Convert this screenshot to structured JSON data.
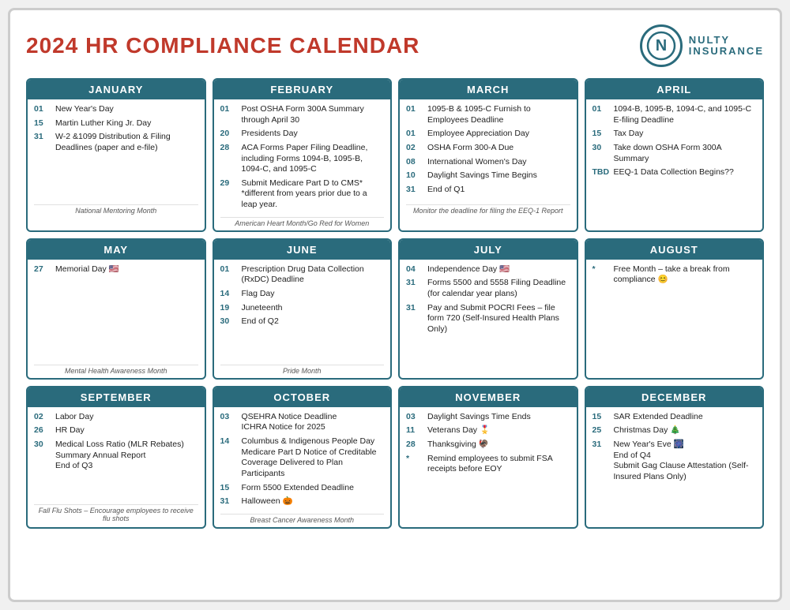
{
  "header": {
    "title": "2024 HR COMPLIANCE CALENDAR",
    "logo_letter": "N",
    "logo_name": "NULTY",
    "logo_sub": "INSURANCE"
  },
  "months": [
    {
      "name": "JANUARY",
      "events": [
        {
          "day": "01",
          "text": "New Year's Day"
        },
        {
          "day": "15",
          "text": "Martin Luther King Jr. Day"
        },
        {
          "day": "31",
          "text": "W-2 &1099 Distribution & Filing Deadlines (paper and e-file)"
        }
      ],
      "footer": "National Mentoring Month"
    },
    {
      "name": "FEBRUARY",
      "events": [
        {
          "day": "01",
          "text": "Post OSHA Form 300A Summary through April 30"
        },
        {
          "day": "20",
          "text": "Presidents Day"
        },
        {
          "day": "28",
          "text": "ACA Forms Paper Filing Deadline, including Forms 1094-B, 1095-B, 1094-C, and 1095-C"
        },
        {
          "day": "29",
          "text": "Submit Medicare Part D to CMS*\n*different from years prior due to a leap year."
        }
      ],
      "footer": "American Heart Month/Go Red for Women"
    },
    {
      "name": "MARCH",
      "events": [
        {
          "day": "01",
          "text": "1095-B & 1095-C Furnish to Employees Deadline"
        },
        {
          "day": "01",
          "text": "Employee Appreciation Day"
        },
        {
          "day": "02",
          "text": "OSHA Form 300-A Due"
        },
        {
          "day": "08",
          "text": "International Women's Day"
        },
        {
          "day": "10",
          "text": "Daylight Savings Time Begins"
        },
        {
          "day": "31",
          "text": "End of Q1"
        }
      ],
      "footer": "Monitor the deadline for filing the EEQ-1 Report"
    },
    {
      "name": "APRIL",
      "events": [
        {
          "day": "01",
          "text": "1094-B, 1095-B, 1094-C, and 1095-C E-filing Deadline"
        },
        {
          "day": "15",
          "text": "Tax Day"
        },
        {
          "day": "30",
          "text": "Take down OSHA Form 300A Summary"
        },
        {
          "day": "TBD",
          "text": "EEQ-1 Data Collection Begins??"
        }
      ],
      "footer": ""
    },
    {
      "name": "MAY",
      "events": [
        {
          "day": "27",
          "text": "Memorial Day 🇺🇸"
        }
      ],
      "footer": "Mental Health Awareness Month"
    },
    {
      "name": "JUNE",
      "events": [
        {
          "day": "01",
          "text": "Prescription Drug Data Collection (RxDC) Deadline"
        },
        {
          "day": "14",
          "text": "Flag Day"
        },
        {
          "day": "19",
          "text": "Juneteenth"
        },
        {
          "day": "30",
          "text": "End of Q2"
        }
      ],
      "footer": "Pride Month"
    },
    {
      "name": "JULY",
      "events": [
        {
          "day": "04",
          "text": "Independence Day 🇺🇸"
        },
        {
          "day": "31",
          "text": "Forms 5500 and 5558 Filing Deadline (for calendar year plans)"
        },
        {
          "day": "31",
          "text": "Pay and Submit POCRI Fees – file form 720 (Self-Insured Health Plans Only)"
        }
      ],
      "footer": ""
    },
    {
      "name": "AUGUST",
      "events": [
        {
          "day": "*",
          "text": "Free Month – take a break from compliance 😊"
        }
      ],
      "footer": ""
    },
    {
      "name": "SEPTEMBER",
      "events": [
        {
          "day": "02",
          "text": "Labor Day"
        },
        {
          "day": "26",
          "text": "HR Day"
        },
        {
          "day": "30",
          "text": "Medical Loss Ratio (MLR Rebates) Summary Annual Report\nEnd of Q3"
        }
      ],
      "footer": "Fall Flu Shots – Encourage employees to receive flu shots"
    },
    {
      "name": "OCTOBER",
      "events": [
        {
          "day": "03",
          "text": "QSEHRA Notice Deadline\nICHRA Notice for 2025"
        },
        {
          "day": "14",
          "text": "Columbus & Indigenous People Day\nMedicare Part D Notice of Creditable Coverage Delivered to Plan Participants"
        },
        {
          "day": "15",
          "text": "Form 5500 Extended Deadline"
        },
        {
          "day": "31",
          "text": "Halloween 🎃"
        }
      ],
      "footer": "Breast Cancer Awareness Month"
    },
    {
      "name": "NOVEMBER",
      "events": [
        {
          "day": "03",
          "text": "Daylight Savings Time Ends"
        },
        {
          "day": "11",
          "text": "Veterans Day 🎖️"
        },
        {
          "day": "28",
          "text": "Thanksgiving 🦃"
        },
        {
          "day": "*",
          "text": "Remind employees to submit FSA receipts before EOY"
        }
      ],
      "footer": ""
    },
    {
      "name": "DECEMBER",
      "events": [
        {
          "day": "15",
          "text": "SAR Extended Deadline"
        },
        {
          "day": "25",
          "text": "Christmas Day 🎄"
        },
        {
          "day": "31",
          "text": "New Year's Eve 🎆\nEnd of Q4\nSubmit Gag Clause Attestation (Self-Insured Plans Only)"
        }
      ],
      "footer": ""
    }
  ]
}
